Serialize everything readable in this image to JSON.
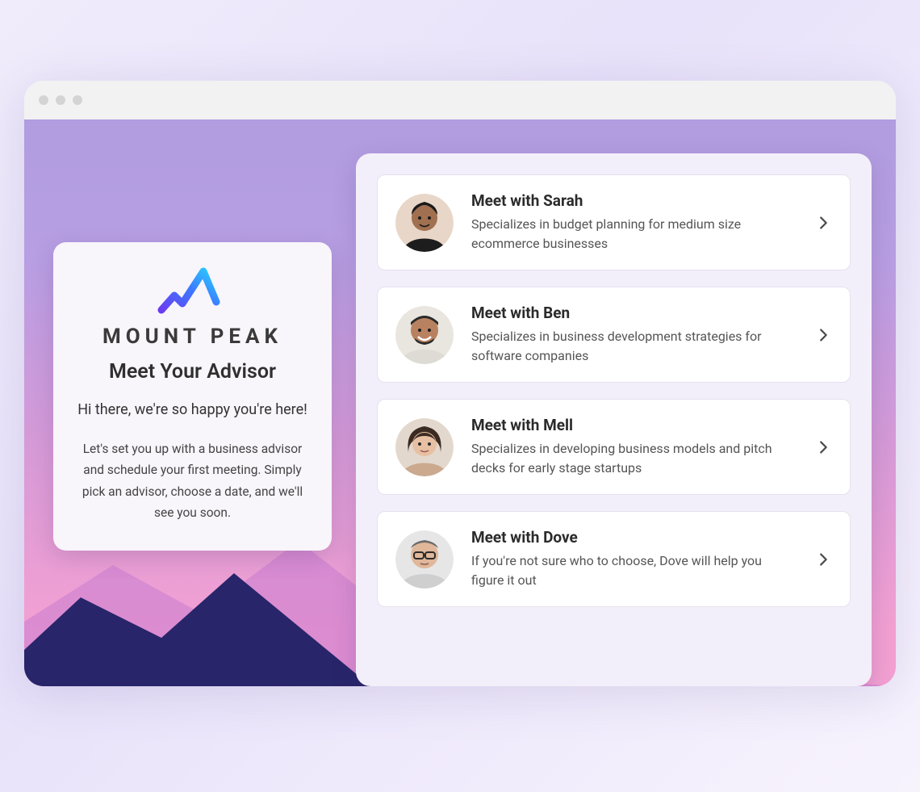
{
  "brand": {
    "name": "MOUNT PEAK"
  },
  "intro": {
    "heading": "Meet Your Advisor",
    "sub": "Hi there, we're so happy you're here!",
    "desc": "Let's set you up with a business advisor and schedule your first meeting. Simply pick an advisor, choose a date, and we'll see you soon."
  },
  "advisors": [
    {
      "title": "Meet with Sarah",
      "desc": "Specializes in budget planning for medium size ecommerce businesses"
    },
    {
      "title": "Meet with Ben",
      "desc": "Specializes in business development strategies for software companies"
    },
    {
      "title": "Meet with Mell",
      "desc": "Specializes in developing business models and pitch decks for early stage startups"
    },
    {
      "title": "Meet with Dove",
      "desc": "If you're not sure who to choose, Dove will help you figure it out"
    }
  ]
}
